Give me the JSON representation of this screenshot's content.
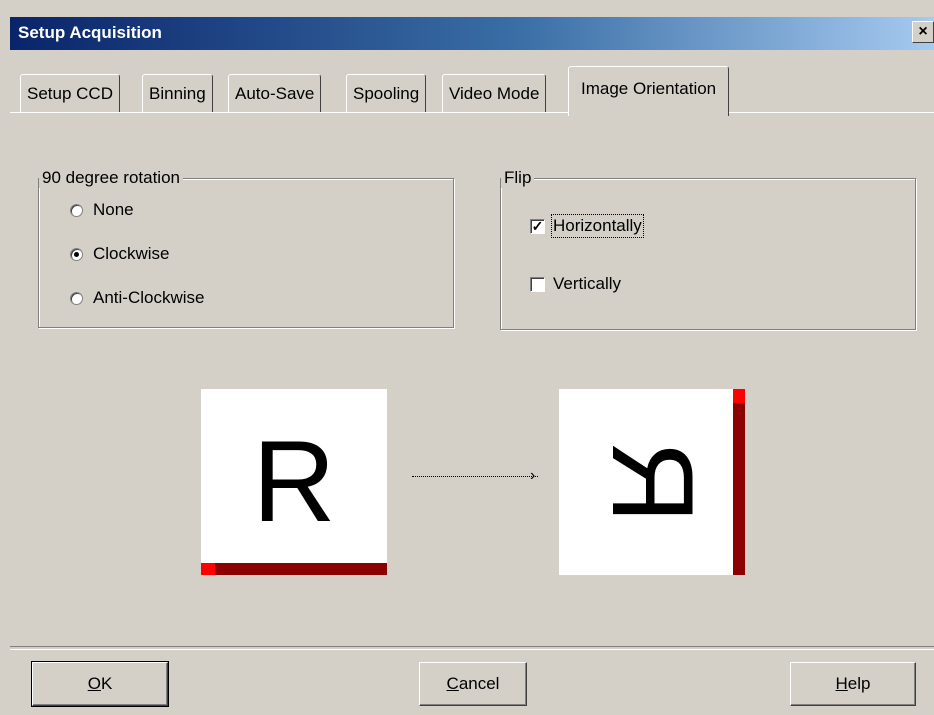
{
  "window": {
    "title": "Setup Acquisition",
    "close_label": "×"
  },
  "tabs": [
    {
      "label": "Setup CCD"
    },
    {
      "label": "Binning"
    },
    {
      "label": "Auto-Save"
    },
    {
      "label": "Spooling"
    },
    {
      "label": "Video Mode"
    },
    {
      "label": "Image Orientation",
      "active": true
    }
  ],
  "rotation": {
    "title": "90 degree rotation",
    "options": [
      {
        "label": "None",
        "selected": false
      },
      {
        "label": "Clockwise",
        "selected": true
      },
      {
        "label": "Anti-Clockwise",
        "selected": false
      }
    ]
  },
  "flip": {
    "title": "Flip",
    "horizontal": {
      "label": "Horizontally",
      "checked": true
    },
    "vertical": {
      "label": "Vertically",
      "checked": false
    }
  },
  "preview": {
    "source_glyph": "R",
    "result_glyph": "R",
    "arrow": "›",
    "marker_color": "#8b0000",
    "marker_accent": "#ff0000"
  },
  "buttons": {
    "ok": {
      "mnemonic": "O",
      "rest": "K"
    },
    "cancel": {
      "mnemonic": "C",
      "rest": "ancel"
    },
    "help": {
      "mnemonic": "H",
      "rest": "elp"
    }
  }
}
